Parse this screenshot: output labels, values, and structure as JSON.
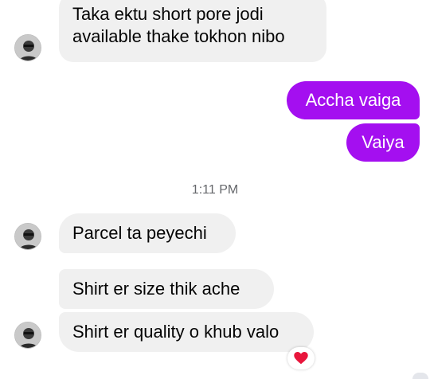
{
  "messages": {
    "m1_line1": "Taka ektu short pore jodi",
    "m1_line2": "available thake tokhon nibo",
    "m2": "Accha vaiga",
    "m3": "Vaiya",
    "m4": "Parcel ta peyechi",
    "m5": "Shirt er size thik ache",
    "m6": "Shirt er quality o khub valo"
  },
  "timestamp": "1:11 PM",
  "reaction": {
    "icon": "heart-icon",
    "color": "#e8163c"
  },
  "colors": {
    "outgoing_bubble": "#a40ff0",
    "incoming_bubble": "#f0f0f0",
    "timestamp_text": "#65676b"
  }
}
